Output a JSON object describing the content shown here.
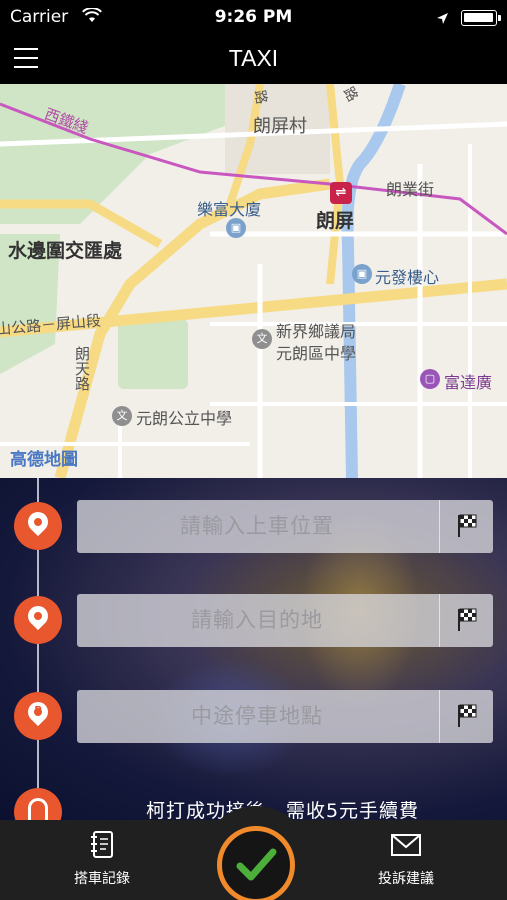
{
  "status_bar": {
    "carrier": "Carrier",
    "time": "9:26 PM"
  },
  "nav": {
    "title": "TAXI"
  },
  "map": {
    "labels": {
      "xitie": "西鐵綫",
      "longping_village": "朗屏村",
      "lok_fu": "樂富大廈",
      "long_ping": "朗屏",
      "long_yip": "朗業街",
      "shui_pin_wai": "水邊圍交匯處",
      "yuen_fat": "元發樓心",
      "castle_road": "山公路－屏山段",
      "long_tin_road": "朗天路",
      "school_a1": "新界鄉議局",
      "school_a2": "元朗區中學",
      "plaza": "富達廣",
      "school_b": "元朗公立中學",
      "road_top": "路",
      "road_top2": "路"
    },
    "mtr_symbol": "⇌",
    "logo": "高德地圖"
  },
  "form": {
    "pickup_placeholder": "請輸入上車位置",
    "destination_placeholder": "請輸入目的地",
    "stop_placeholder": "中途停車地點",
    "notice": "柯打成功接後，需收5元手續費"
  },
  "tabs": {
    "history": "搭車記錄",
    "complaint": "投訴建議"
  },
  "colors": {
    "accent": "#e8572e",
    "confirm_ring": "#f08a2b",
    "confirm_check": "#4caf3a"
  }
}
